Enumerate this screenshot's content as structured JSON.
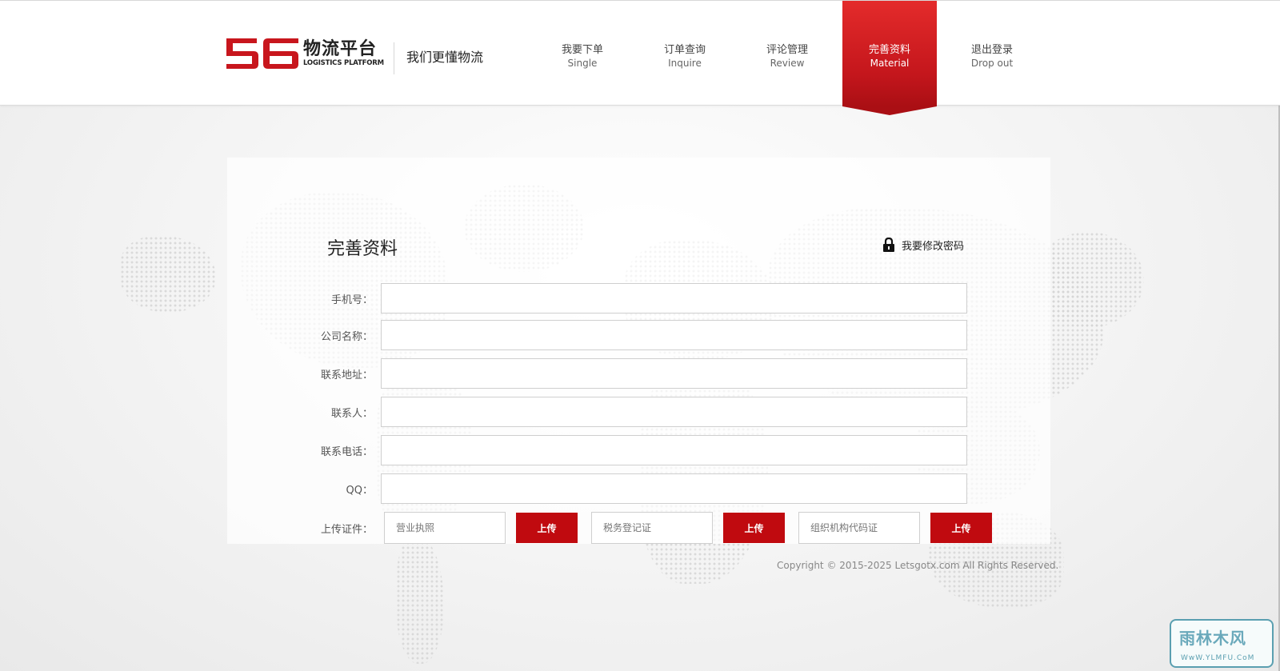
{
  "header": {
    "logo_number": "56",
    "logo_cn": "物流平台",
    "logo_en": "LOGISTICS PLATFORM",
    "slogan": "我们更懂物流",
    "nav": [
      {
        "cn": "我要下单",
        "en": "Single",
        "active": false
      },
      {
        "cn": "订单查询",
        "en": "Inquire",
        "active": false
      },
      {
        "cn": "评论管理",
        "en": "Review",
        "active": false
      },
      {
        "cn": "完善资料",
        "en": "Material",
        "active": true
      },
      {
        "cn": "退出登录",
        "en": "Drop out",
        "active": false
      }
    ]
  },
  "form": {
    "title": "完善资料",
    "change_password": "我要修改密码",
    "fields": [
      {
        "label": "手机号：",
        "value": ""
      },
      {
        "label": "公司名称：",
        "value": ""
      },
      {
        "label": "联系地址：",
        "value": ""
      },
      {
        "label": "联系人：",
        "value": ""
      },
      {
        "label": "联系电话：",
        "value": ""
      },
      {
        "label": "QQ：",
        "value": ""
      }
    ],
    "upload": {
      "label": "上传证件：",
      "items": [
        {
          "placeholder": "营业执照",
          "button": "上传"
        },
        {
          "placeholder": "税务登记证",
          "button": "上传"
        },
        {
          "placeholder": "组织机构代码证",
          "button": "上传"
        }
      ]
    }
  },
  "footer": {
    "copyright": "Copyright © 2015-2025 Letsgotx.com All Rights Reserved."
  },
  "watermark": {
    "cn": "雨林木风",
    "en": "WwW.YLMFU.CoM"
  },
  "colors": {
    "accent": "#c00a0f",
    "nav_active_top": "#e42b2b",
    "nav_active_bottom": "#aa0f14",
    "logo_red": "#c8161d"
  }
}
